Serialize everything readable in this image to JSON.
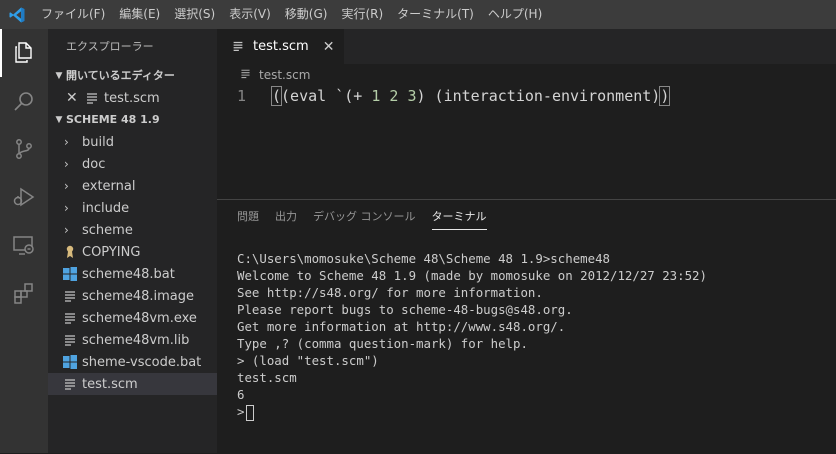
{
  "menu": [
    "ファイル(F)",
    "編集(E)",
    "選択(S)",
    "表示(V)",
    "移動(G)",
    "実行(R)",
    "ターミナル(T)",
    "ヘルプ(H)"
  ],
  "colors": {
    "accent": "#007acc",
    "folder_icon": "#c5c5c5",
    "bat_icon": "#4fa3e0",
    "license_icon": "#d7ba7d"
  },
  "activity_icons": [
    "explorer-icon",
    "search-icon",
    "source-control-icon",
    "run-debug-icon",
    "remote-explorer-icon",
    "extensions-icon"
  ],
  "sidebar": {
    "title": "エクスプローラー",
    "open_editors": {
      "header": "開いているエディター",
      "file": "test.scm"
    },
    "folder": {
      "header": "SCHEME 48 1.9",
      "folders": [
        "build",
        "doc",
        "external",
        "include",
        "scheme"
      ],
      "files": [
        {
          "name": "COPYING",
          "icon": "license-icon"
        },
        {
          "name": "scheme48.bat",
          "icon": "windows-icon"
        },
        {
          "name": "scheme48.image",
          "icon": "lines-icon"
        },
        {
          "name": "scheme48vm.exe",
          "icon": "lines-icon"
        },
        {
          "name": "scheme48vm.lib",
          "icon": "lines-icon"
        },
        {
          "name": "sheme-vscode.bat",
          "icon": "windows-icon"
        },
        {
          "name": "test.scm",
          "icon": "lines-icon"
        }
      ]
    }
  },
  "editor": {
    "tab": "test.scm",
    "breadcrumb": "test.scm",
    "line_number": "1",
    "code": {
      "a": "(eval `(+ ",
      "n1": "1",
      "n2": "2",
      "n3": "3",
      "b": ") (interaction-environment)",
      "close": ")"
    }
  },
  "panel": {
    "tabs": [
      "問題",
      "出力",
      "デバッグ コンソール",
      "ターミナル"
    ],
    "active_tab": "ターミナル",
    "terminal_lines": [
      "C:\\Users\\momosuke\\Scheme 48\\Scheme 48 1.9>scheme48",
      "Welcome to Scheme 48 1.9 (made by momosuke on 2012/12/27 23:52)",
      "See http://s48.org/ for more information.",
      "Please report bugs to scheme-48-bugs@s48.org.",
      "Get more information at http://www.s48.org/.",
      "Type ,? (comma question-mark) for help.",
      "> (load \"test.scm\")",
      "test.scm",
      "6"
    ],
    "prompt": ">"
  }
}
